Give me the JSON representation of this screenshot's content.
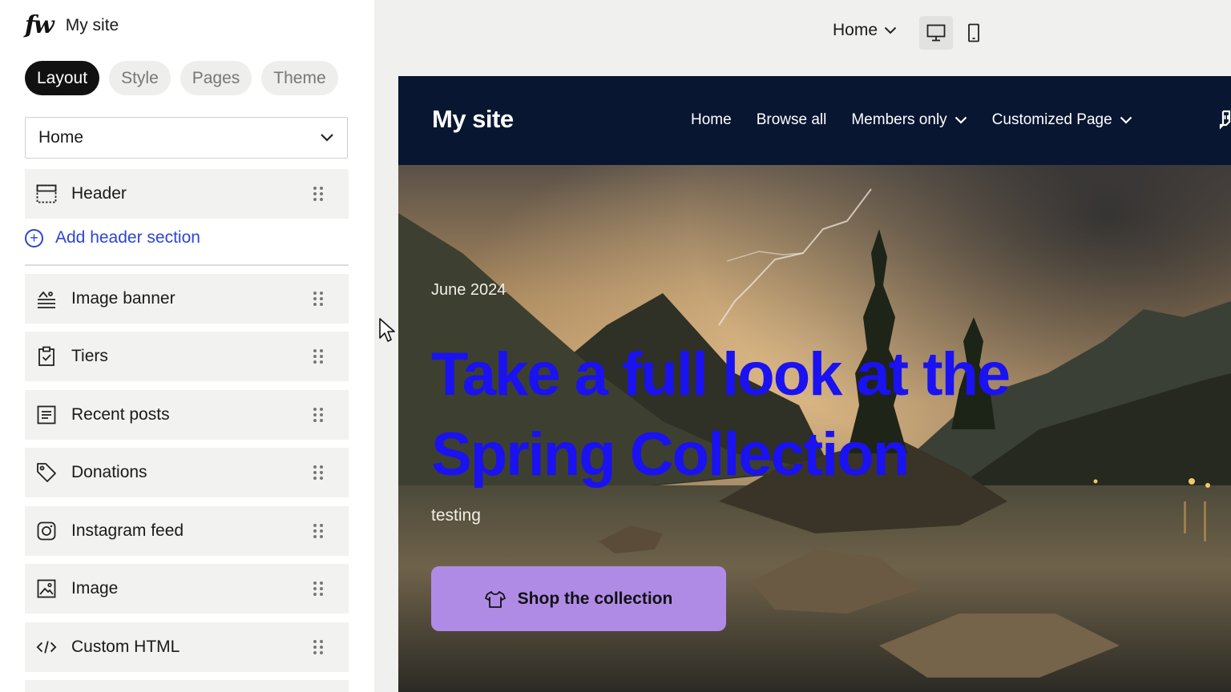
{
  "sidebar": {
    "site_name": "My site",
    "tabs": [
      {
        "label": "Layout",
        "active": true
      },
      {
        "label": "Style",
        "active": false
      },
      {
        "label": "Pages",
        "active": false
      },
      {
        "label": "Theme",
        "active": false
      }
    ],
    "page_select": {
      "value": "Home"
    },
    "header_section": {
      "label": "Header",
      "icon": "header-layout-icon"
    },
    "add_header_label": "Add header section",
    "sections": [
      {
        "label": "Image banner",
        "icon": "image-banner-icon"
      },
      {
        "label": "Tiers",
        "icon": "tiers-clipboard-icon"
      },
      {
        "label": "Recent posts",
        "icon": "recent-posts-icon"
      },
      {
        "label": "Donations",
        "icon": "tag-icon"
      },
      {
        "label": "Instagram feed",
        "icon": "instagram-icon"
      },
      {
        "label": "Image",
        "icon": "image-icon"
      },
      {
        "label": "Custom HTML",
        "icon": "code-icon"
      }
    ]
  },
  "topbar": {
    "preview_page": "Home",
    "devices": [
      {
        "name": "desktop",
        "icon": "desktop-monitor-icon",
        "active": true
      },
      {
        "name": "mobile",
        "icon": "mobile-phone-icon",
        "active": false
      }
    ]
  },
  "preview": {
    "site_title": "My site",
    "nav": [
      {
        "label": "Home",
        "dropdown": false
      },
      {
        "label": "Browse all",
        "dropdown": false
      },
      {
        "label": "Members only",
        "dropdown": true
      },
      {
        "label": "Customized Page",
        "dropdown": true
      }
    ],
    "hero": {
      "date": "June 2024",
      "title": "Take a full look at the Spring Collection",
      "subtitle": "testing",
      "cta_label": "Shop the collection",
      "cta_icon": "tshirt-icon"
    }
  },
  "colors": {
    "accent_blue": "#2b45d6",
    "nav_bg": "#081631",
    "hero_title": "#1a12f0",
    "cta_bg": "#b08be6"
  }
}
